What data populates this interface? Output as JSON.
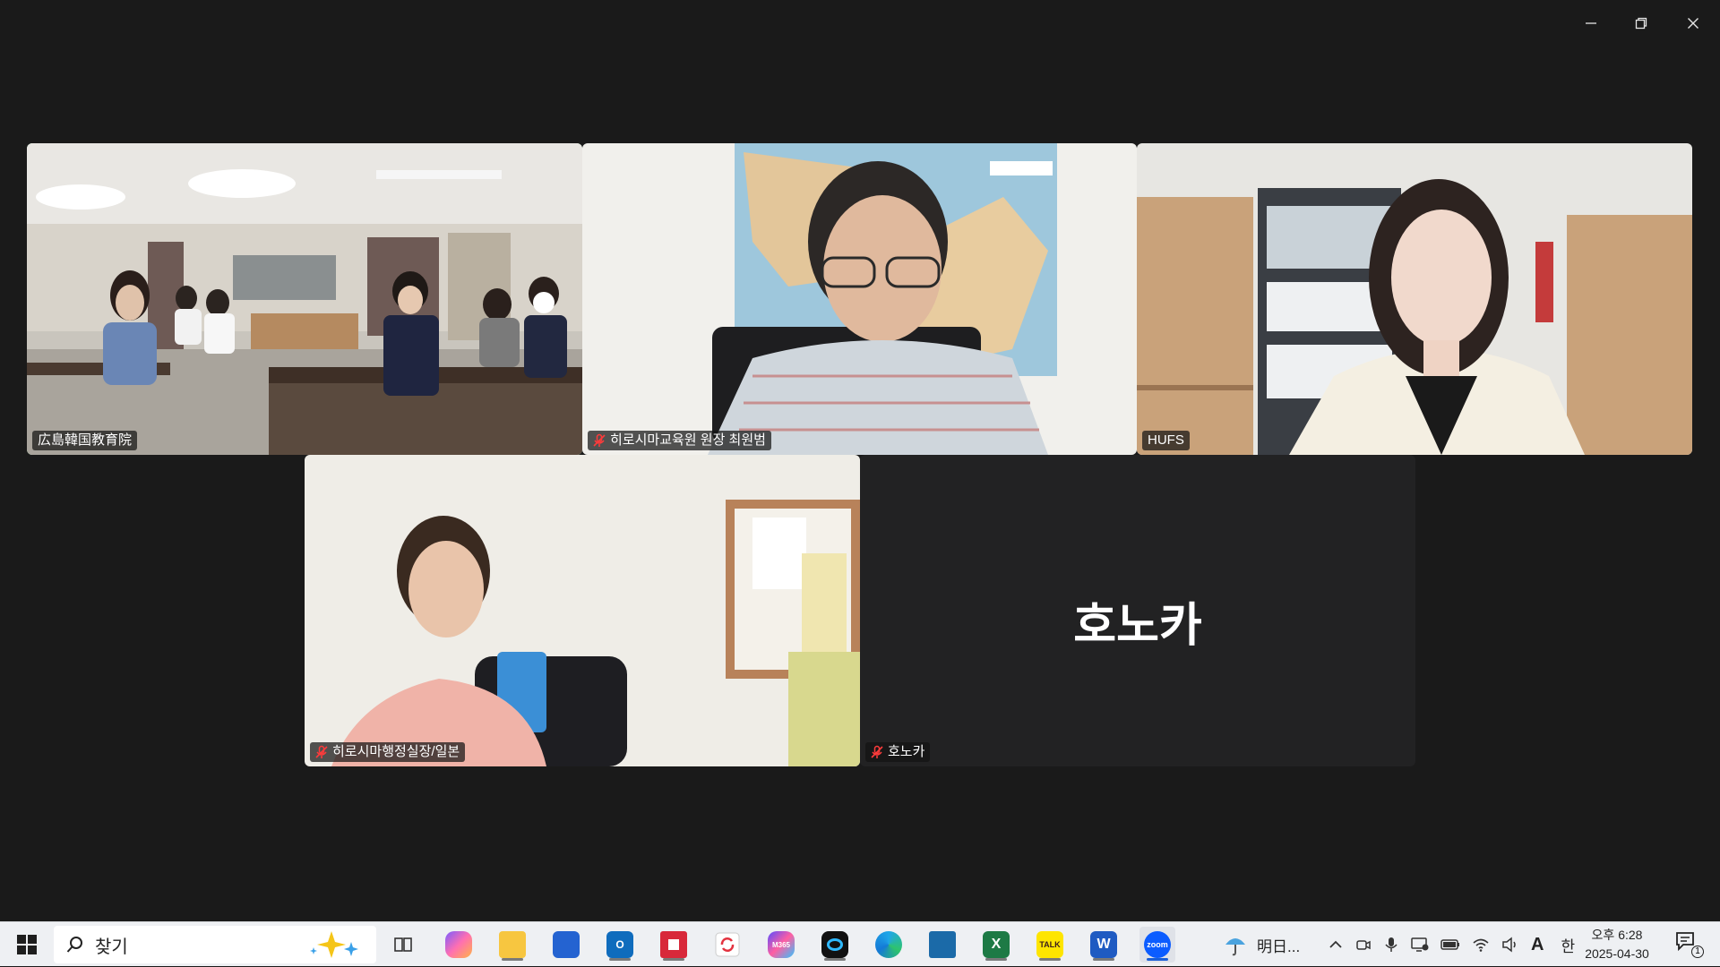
{
  "window": {
    "controls": [
      "minimize",
      "restore",
      "close"
    ]
  },
  "participants": {
    "classroom": {
      "name": "広島韓国教育院",
      "muted": false,
      "active_speaker": true
    },
    "director": {
      "name": "히로시마교육원 원장 최원범",
      "muted": true
    },
    "hufs": {
      "name": "HUFS",
      "muted": false
    },
    "admin": {
      "name": "히로시마행정실장/일본",
      "muted": true
    },
    "honoka": {
      "name": "호노카",
      "display_name": "호노카",
      "muted": true,
      "video_off": true
    }
  },
  "taskbar": {
    "search_placeholder": "찾기",
    "weather_text": "明日...",
    "ime_mode": "A",
    "ime_lang": "한",
    "clock_time": "오후 6:28",
    "clock_date": "2025-04-30",
    "notification_count": "1",
    "apps": [
      "task-view",
      "copilot",
      "file-explorer",
      "microsoft-store",
      "outlook",
      "remote-app",
      "sync-app",
      "m365",
      "webex",
      "edge",
      "kiosk-app",
      "excel",
      "kakaotalk",
      "word",
      "zoom"
    ],
    "app_labels": {
      "kakaotalk": "TALK",
      "excel": "X",
      "word": "W",
      "zoom": "zoom",
      "m365": "M365"
    }
  },
  "colors": {
    "active_speaker_border": "#23d96b",
    "zoom_blue": "#0b5cff",
    "background": "#1a1a1a"
  }
}
